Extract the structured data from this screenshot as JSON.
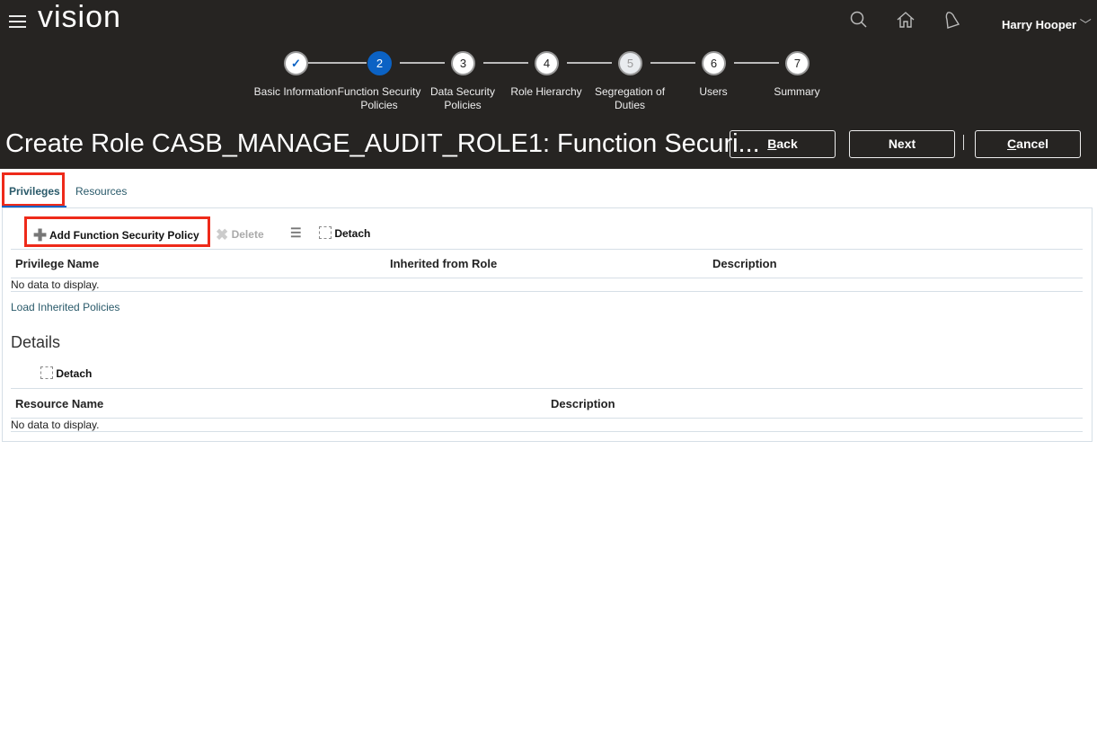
{
  "header": {
    "app_name": "vision",
    "user_name": "Harry Hooper",
    "icons": [
      "menu-icon",
      "search-icon",
      "home-icon",
      "bell-icon",
      "chevron-down-icon"
    ]
  },
  "train": {
    "steps": [
      {
        "num": "✓",
        "label": "Basic Information",
        "state": "done"
      },
      {
        "num": "2",
        "label": "Function Security Policies",
        "state": "current"
      },
      {
        "num": "3",
        "label": "Data Security Policies",
        "state": "todo"
      },
      {
        "num": "4",
        "label": "Role Hierarchy",
        "state": "todo"
      },
      {
        "num": "5",
        "label": "Segregation of Duties",
        "state": "disabled"
      },
      {
        "num": "6",
        "label": "Users",
        "state": "todo"
      },
      {
        "num": "7",
        "label": "Summary",
        "state": "todo"
      }
    ]
  },
  "page": {
    "title": "Create Role CASB_MANAGE_AUDIT_ROLE1: Function Securi...",
    "back": "Back",
    "next": "Next",
    "cancel": "Cancel"
  },
  "tabs": {
    "privileges": "Privileges",
    "resources": "Resources"
  },
  "toolbar": {
    "add": "Add Function Security Policy",
    "delete": "Delete",
    "detach": "Detach"
  },
  "privileges_table": {
    "columns": [
      "Privilege Name",
      "Inherited from Role",
      "Description"
    ],
    "empty": "No data to display."
  },
  "load_inherited": "Load Inherited Policies",
  "details": {
    "heading": "Details",
    "detach": "Detach",
    "columns": [
      "Resource Name",
      "Description"
    ],
    "empty": "No data to display."
  },
  "colors": {
    "header_bg": "#262422",
    "current_step": "#0b62c4",
    "highlight": "#ee2a1a",
    "link": "#2a5a6a"
  }
}
